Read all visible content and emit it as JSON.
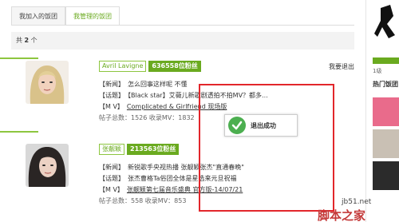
{
  "tabs": [
    {
      "label": "我加入的饭团",
      "active": false
    },
    {
      "label": "我管理的饭团",
      "active": true
    }
  ],
  "count": {
    "prefix": "共",
    "value": "2",
    "suffix": "个"
  },
  "groups": [
    {
      "name": "Avril Lavigne",
      "fans_count": "636558",
      "fans_label": "位粉丝",
      "quit_label": "我要退出",
      "lines": [
        {
          "tag": "【新闻】",
          "text": "怎么回事这样呢 不懂"
        },
        {
          "tag": "【话题】",
          "text": "【Black star】艾薇儿新歌剧透拍不拍MV？都多..."
        },
        {
          "tag": "【M V】",
          "text": "Complicated & Girlfriend 现场版"
        }
      ],
      "stats": "帖子总数：1526  收录MV：1832"
    },
    {
      "name": "张靓颖",
      "fans_count": "213563",
      "fans_label": "位粉丝",
      "lines": [
        {
          "tag": "【新闻】",
          "text": "新锐歌手央视热播 张靓颖张杰\"直通春晚\""
        },
        {
          "tag": "【话题】",
          "text": "张杰曹格Ta俗团全体是星选来元旦祝福"
        },
        {
          "tag": "【M V】",
          "text": "张靓颖第七届音乐盛典 官方版-14/07/21"
        }
      ],
      "stats": "帖子总数：558  收录MV：853"
    }
  ],
  "toast": {
    "message": "退出成功"
  },
  "sidebar": {
    "level": "1级",
    "hot_title": "热门饭团"
  },
  "watermark": {
    "site": "jb51.net",
    "brand": "脚本之家"
  },
  "colors": {
    "accent": "#6aaa1f",
    "highlight": "#e2262b",
    "success": "#4caf50"
  }
}
